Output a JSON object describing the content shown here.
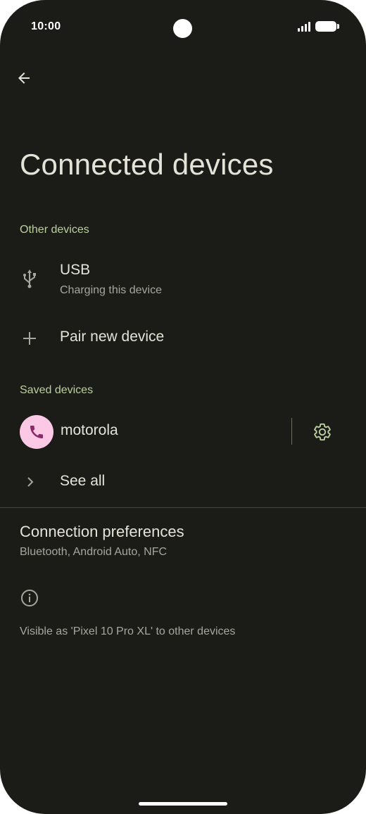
{
  "status_bar": {
    "time": "10:00"
  },
  "page": {
    "title": "Connected devices"
  },
  "sections": {
    "other_devices": {
      "header": "Other devices",
      "usb": {
        "title": "USB",
        "subtitle": "Charging this device",
        "icon": "usb-icon"
      },
      "pair": {
        "title": "Pair new device",
        "icon": "plus-icon"
      }
    },
    "saved_devices": {
      "header": "Saved devices",
      "device": {
        "name": "motorola",
        "icon": "phone-icon",
        "settings_icon": "gear-icon"
      },
      "see_all": {
        "label": "See all",
        "icon": "chevron-right-icon"
      }
    },
    "connection_preferences": {
      "title": "Connection preferences",
      "subtitle": "Bluetooth, Android Auto, NFC"
    }
  },
  "footer": {
    "icon": "info-icon",
    "text": "Visible as 'Pixel 10 Pro XL' to other devices"
  },
  "colors": {
    "background": "#1b1c17",
    "accent": "#bdcfa0",
    "avatar_bg": "#fbc9e6",
    "avatar_icon": "#8a2a68"
  }
}
